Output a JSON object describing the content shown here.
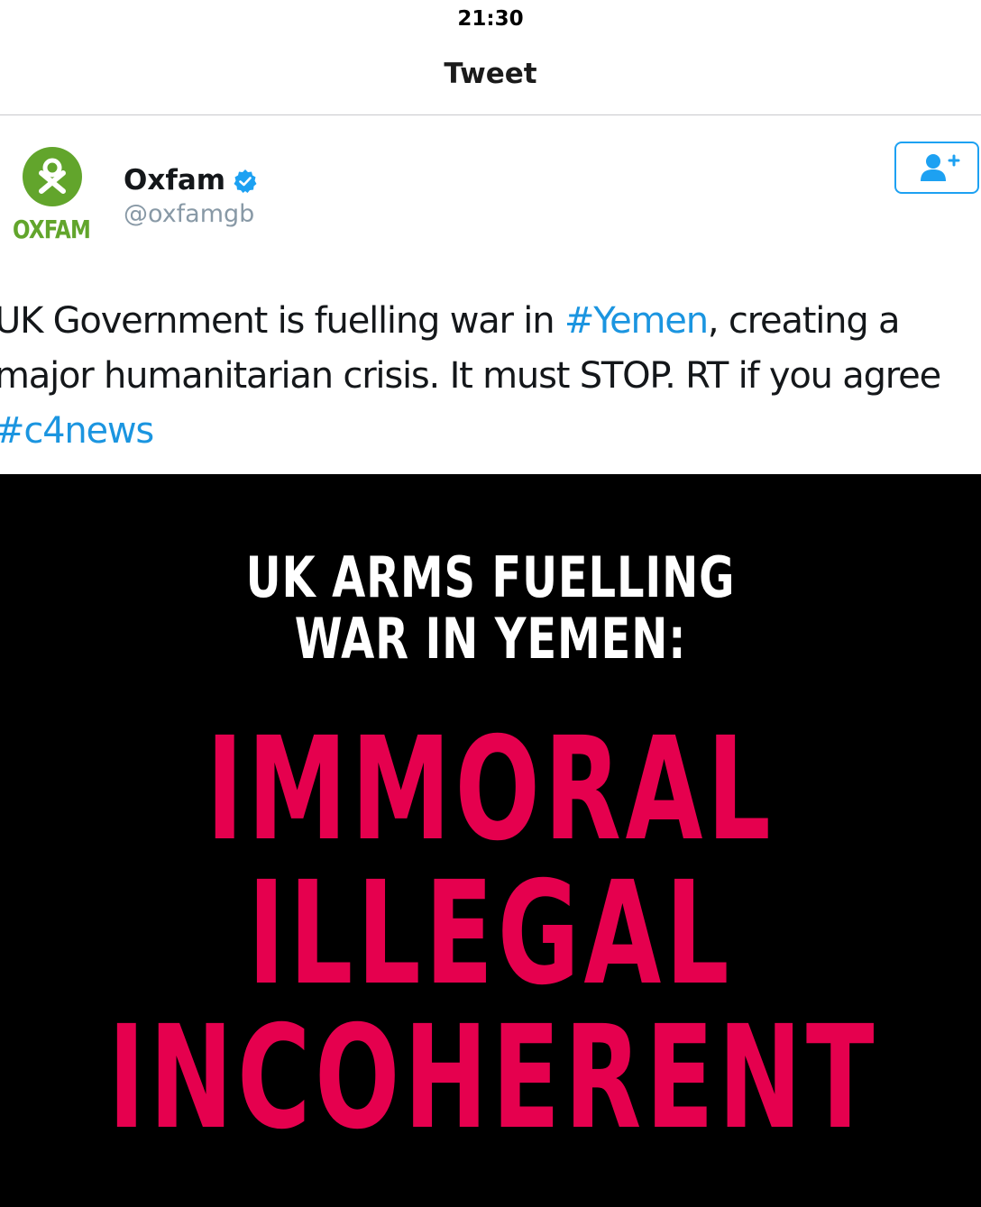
{
  "status_bar": {
    "time": "21:30"
  },
  "nav": {
    "title": "Tweet"
  },
  "author": {
    "avatar_text": "OXFAM",
    "display_name": "Oxfam",
    "handle": "@oxfamgb",
    "verified": true
  },
  "follow_button": {
    "icon": "follow-user-plus-icon"
  },
  "tweet": {
    "text_1": "UK Government is fuelling war in ",
    "hashtag_1": "#Yemen",
    "text_2": ", creating a major humanitarian crisis. It must STOP. RT if you agree ",
    "hashtag_2": "#c4news"
  },
  "media": {
    "headline_1": "UK ARMS FUELLING",
    "headline_2": "WAR IN YEMEN:",
    "word_1": "IMMORAL",
    "word_2": "ILLEGAL",
    "word_3": "INCOHERENT"
  },
  "colors": {
    "link": "#1b95e0",
    "oxfam_green": "#62a52c",
    "media_accent": "#e5004e",
    "follow_blue": "#1da1f2"
  }
}
